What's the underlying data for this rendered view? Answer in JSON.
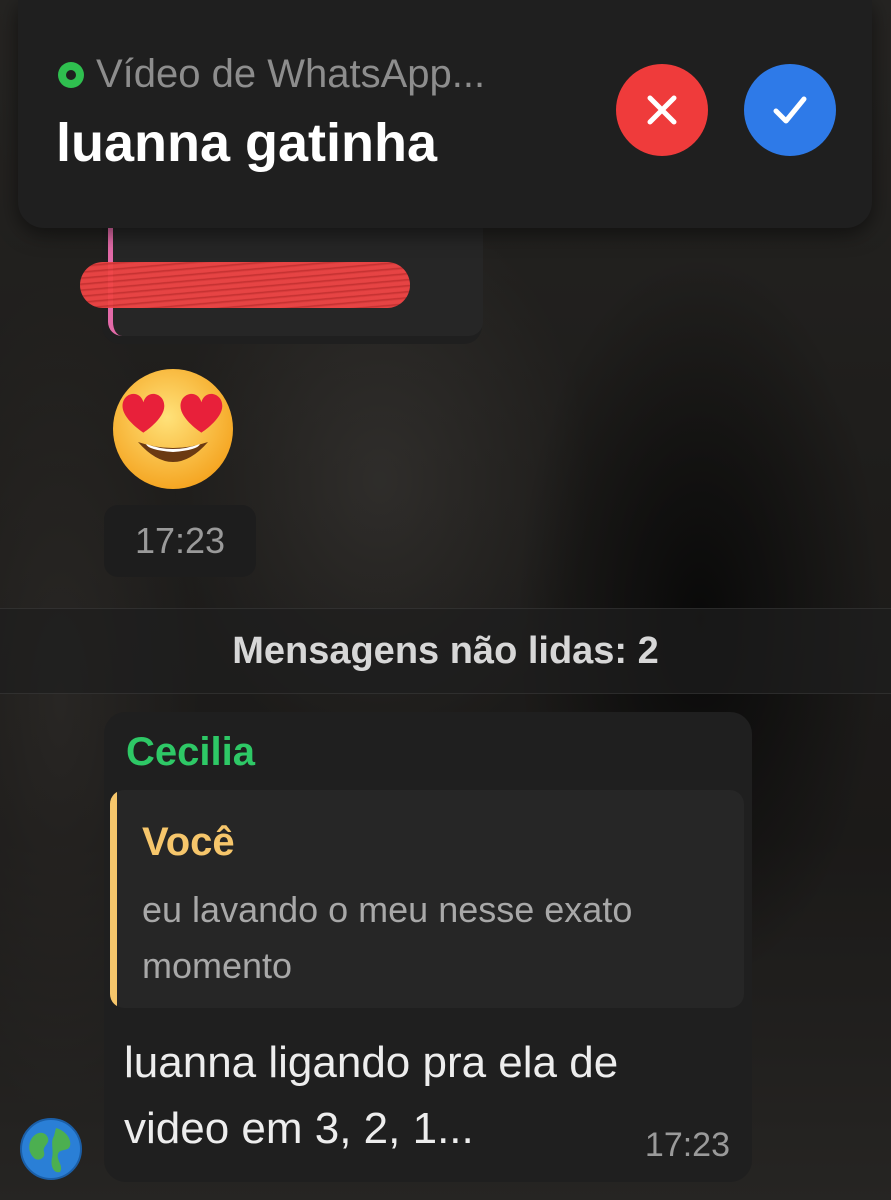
{
  "notification": {
    "app_name": "Vídeo de WhatsApp...",
    "caller": "luanna gatinha",
    "app_icon": "whatsapp-icon",
    "decline_icon": "close-icon",
    "accept_icon": "check-icon",
    "colors": {
      "decline": "#ef3b3b",
      "accept": "#2e7ae8"
    }
  },
  "chat": {
    "previous_message": {
      "emoji": "smiling-face-with-heart-eyes",
      "time": "17:23"
    },
    "unread_divider": "Mensagens não lidas: 2",
    "message": {
      "sender": "Cecilia",
      "sender_color": "#2ec866",
      "reply": {
        "author": "Você",
        "text": "eu lavando o meu nesse exato momento"
      },
      "text": "luanna ligando pra ela de video em 3, 2, 1...",
      "time": "17:23",
      "avatar_icon": "globe-avatar"
    }
  }
}
